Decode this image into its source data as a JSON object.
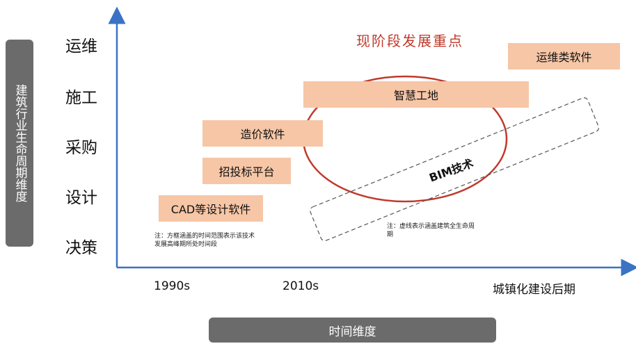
{
  "y_axis_title": "建筑行业生命周期维度",
  "x_axis_title": "时间维度",
  "stages": [
    "运维",
    "施工",
    "采购",
    "设计",
    "决策"
  ],
  "x_ticks": [
    "1990s",
    "2010s",
    "城镇化建设后期"
  ],
  "bars": {
    "cad": "CAD等设计软件",
    "bidding": "招投标平台",
    "cost": "造价软件",
    "site": "智慧工地",
    "om": "运维类软件"
  },
  "focus_label": "现阶段发展重点",
  "bim_label": "BIM技术",
  "notes": {
    "box_note": "注：方框涵盖的时间范围表示该技术发展高峰期所处时间段",
    "dashed_note": "注：虚线表示涵盖建筑全生命周期"
  },
  "colors": {
    "bar_fill": "#f6c6a6",
    "axis": "#3a72c4",
    "focus": "#c0392b",
    "pill": "#6b6b6b"
  }
}
